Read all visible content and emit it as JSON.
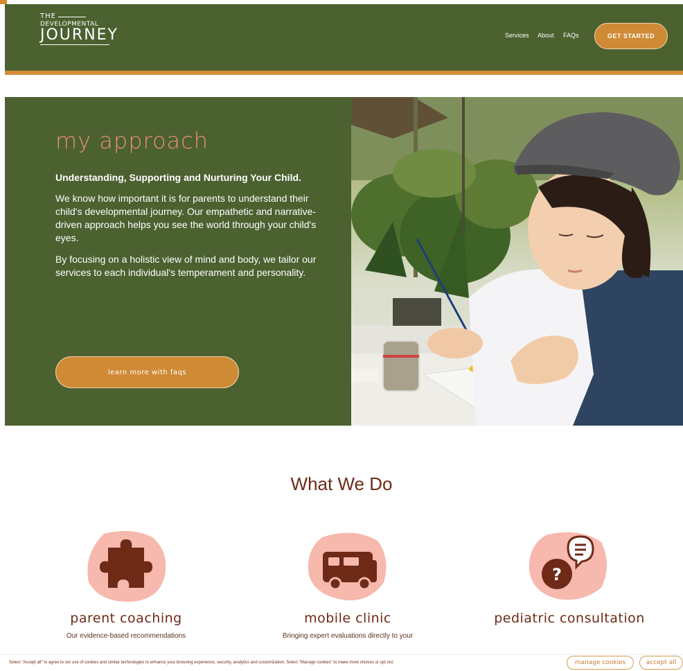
{
  "header": {
    "logo_line1": "THE",
    "logo_line2": "DEVELOPMENTAL",
    "logo_line3": "JOURNEY",
    "nav": [
      "Services",
      "About",
      "FAQs"
    ],
    "cta": "GET STARTED"
  },
  "approach": {
    "title": "my approach",
    "subtitle": "Understanding, Supporting and Nurturing Your Child.",
    "para1": "We know how important it is for parents to understand their child's developmental journey. Our empathetic and narrative-driven approach helps you see the world through your child's eyes.",
    "para2": "By focusing on a holistic view of mind and body, we tailor our services to each individual's temperament and personality.",
    "button": "Learn more with FAQs"
  },
  "what_we_do": {
    "title": "What We Do",
    "services": [
      {
        "title": "Parent Coaching",
        "icon": "puzzle-piece-icon",
        "desc": "Our evidence-based recommendations"
      },
      {
        "title": "Mobile Clinic",
        "icon": "rv-camper-icon",
        "desc": "Bringing expert evaluations directly to your"
      },
      {
        "title": "Pediatric Consultation",
        "icon": "question-chat-icon",
        "desc": ""
      }
    ]
  },
  "cookie": {
    "text": "Select \"Accept all\" to agree to our use of cookies and similar technologies to enhance your browsing experience, security, analytics and customization. Select \"Manage cookies\" to make more choices or opt out.",
    "manage": "Manage cookies",
    "accept": "Accept all"
  },
  "colors": {
    "green": "#4b6130",
    "orange": "#cf8a35",
    "salmon": "#ea8f74",
    "brown": "#6e2a17",
    "blob": "#f7b8ae"
  }
}
